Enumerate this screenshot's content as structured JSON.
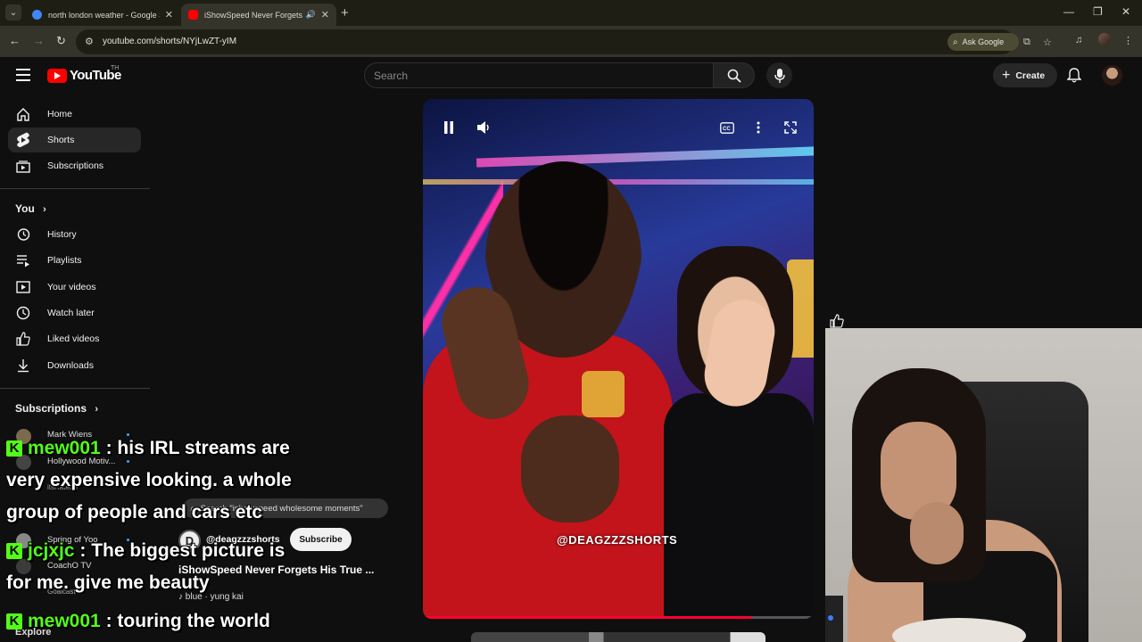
{
  "browser": {
    "tabs": [
      {
        "title": "north london weather - Google Search",
        "favicon_color": "#4285f4",
        "active": false
      },
      {
        "title": "iShowSpeed Never Forgets His True ...",
        "favicon_color": "#ff0000",
        "active": true
      }
    ],
    "url": "youtube.com/shorts/NYjLwZT-yIM",
    "ask_google_label": "Ask Google"
  },
  "youtube": {
    "logo_text": "YouTube",
    "country_code": "TH",
    "search_placeholder": "Search",
    "create_label": "Create",
    "brand_color": "#ff0000"
  },
  "sidebar": {
    "primary": [
      {
        "label": "Home",
        "icon": "home-icon"
      },
      {
        "label": "Shorts",
        "icon": "shorts-icon",
        "active": true
      },
      {
        "label": "Subscriptions",
        "icon": "subscriptions-icon"
      }
    ],
    "you_heading": "You",
    "you_items": [
      {
        "label": "History",
        "icon": "history-icon"
      },
      {
        "label": "Playlists",
        "icon": "playlists-icon"
      },
      {
        "label": "Your videos",
        "icon": "your-videos-icon"
      },
      {
        "label": "Watch later",
        "icon": "watch-later-icon"
      },
      {
        "label": "Liked videos",
        "icon": "liked-videos-icon"
      },
      {
        "label": "Downloads",
        "icon": "downloads-icon"
      }
    ],
    "subscriptions_heading": "Subscriptions",
    "subscriptions": [
      {
        "name": "Mark Wiens"
      },
      {
        "name": "Hollywood Motiv..."
      },
      {
        "name": "itsRaterin"
      },
      {
        "name": ""
      },
      {
        "name": "Spring of Yoo"
      },
      {
        "name": "CoachO TV"
      },
      {
        "name": "Goalcast"
      }
    ],
    "explore_heading": "Explore"
  },
  "short": {
    "search_suggestion": "Search \"ishowspeed wholesome moments\"",
    "channel_initial": "D",
    "channel_handle": "@deagzzzshorts",
    "subscribe_label": "Subscribe",
    "title": "iShowSpeed Never Forgets His True ...",
    "music": "blue · yung kai",
    "watermark": "@DEAGZZZSHORTS",
    "progress_fraction": 0.84
  },
  "chat": [
    {
      "user": "mew001",
      "lines": [
        ": his IRL streams are",
        "very expensive looking. a whole",
        "group of people and cars etc"
      ]
    },
    {
      "user": "jcjxjc",
      "lines": [
        ": The biggest picture is",
        "for me. give me beauty"
      ]
    },
    {
      "user": "mew001",
      "lines": [
        ": touring the world"
      ]
    }
  ],
  "chat_accent": "#53fc18"
}
